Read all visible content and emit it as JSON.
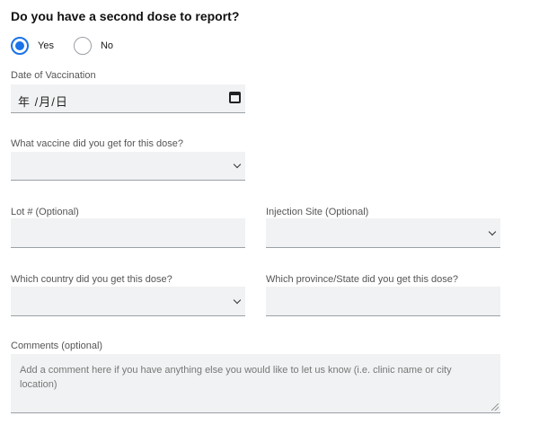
{
  "question": "Do you have a second dose to report?",
  "radio": {
    "options": [
      {
        "label": "Yes",
        "selected": true
      },
      {
        "label": "No",
        "selected": false
      }
    ]
  },
  "date": {
    "label": "Date of Vaccination",
    "value": "年 /月/日"
  },
  "vaccine": {
    "label": "What vaccine did you get for this dose?",
    "value": ""
  },
  "lot": {
    "label": "Lot # (Optional)",
    "value": ""
  },
  "injection_site": {
    "label": "Injection Site (Optional)",
    "value": ""
  },
  "country": {
    "label": "Which country did you get this dose?",
    "value": ""
  },
  "province": {
    "label": "Which province/State did you get this dose?",
    "value": ""
  },
  "comments": {
    "label": "Comments (optional)",
    "placeholder": "Add a comment here if you have anything else you would like to let us know (i.e. clinic name or city location)"
  },
  "colors": {
    "accent": "#1a73e8",
    "field_bg": "#f1f2f3",
    "field_border": "#9aa0a6"
  }
}
